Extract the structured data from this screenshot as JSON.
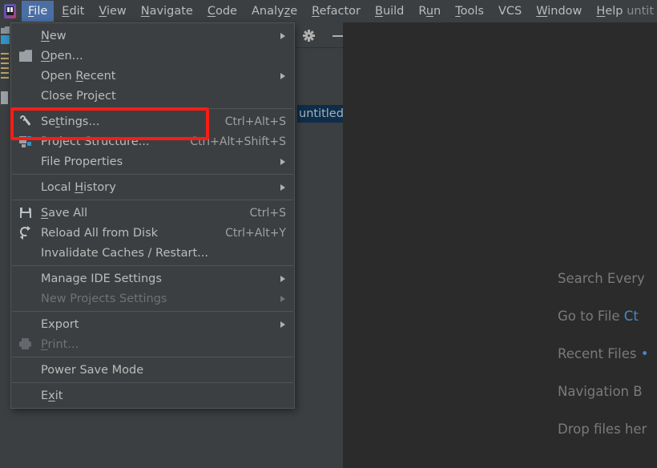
{
  "window": {
    "title": "untit",
    "app_icon": "intellij-idea-logo"
  },
  "menubar": {
    "items": [
      {
        "label": "File",
        "mnemonic": "F",
        "active": true
      },
      {
        "label": "Edit",
        "mnemonic": "E",
        "active": false
      },
      {
        "label": "View",
        "mnemonic": "V",
        "active": false
      },
      {
        "label": "Navigate",
        "mnemonic": "N",
        "active": false
      },
      {
        "label": "Code",
        "mnemonic": "C",
        "active": false
      },
      {
        "label": "Analyze",
        "mnemonic": "z",
        "active": false
      },
      {
        "label": "Refactor",
        "mnemonic": "R",
        "active": false
      },
      {
        "label": "Build",
        "mnemonic": "B",
        "active": false
      },
      {
        "label": "Run",
        "mnemonic": "u",
        "active": false
      },
      {
        "label": "Tools",
        "mnemonic": "T",
        "active": false
      },
      {
        "label": "VCS",
        "mnemonic": "",
        "active": false
      },
      {
        "label": "Window",
        "mnemonic": "W",
        "active": false
      },
      {
        "label": "Help",
        "mnemonic": "H",
        "active": false
      }
    ],
    "active_color": "#4a6fa5"
  },
  "file_menu": {
    "rows": [
      {
        "type": "item",
        "label": "New",
        "mnemonic": "N",
        "keys": "",
        "icon": "none",
        "submenu": true,
        "disabled": false
      },
      {
        "type": "item",
        "label": "Open...",
        "mnemonic": "O",
        "keys": "",
        "icon": "folder",
        "submenu": false,
        "disabled": false
      },
      {
        "type": "item",
        "label": "Open Recent",
        "mnemonic": "R",
        "keys": "",
        "icon": "none",
        "submenu": true,
        "disabled": false
      },
      {
        "type": "item",
        "label": "Close Project",
        "mnemonic": "",
        "keys": "",
        "icon": "none",
        "submenu": false,
        "disabled": false
      },
      {
        "type": "separator"
      },
      {
        "type": "item",
        "label": "Settings...",
        "mnemonic": "t",
        "keys": "Ctrl+Alt+S",
        "icon": "wrench",
        "submenu": false,
        "disabled": false,
        "highlighted": true
      },
      {
        "type": "item",
        "label": "Project Structure...",
        "mnemonic": "",
        "keys": "Ctrl+Alt+Shift+S",
        "icon": "structure",
        "submenu": false,
        "disabled": false
      },
      {
        "type": "item",
        "label": "File Properties",
        "mnemonic": "",
        "keys": "",
        "icon": "none",
        "submenu": true,
        "disabled": false
      },
      {
        "type": "separator"
      },
      {
        "type": "item",
        "label": "Local History",
        "mnemonic": "H",
        "keys": "",
        "icon": "none",
        "submenu": true,
        "disabled": false
      },
      {
        "type": "separator"
      },
      {
        "type": "item",
        "label": "Save All",
        "mnemonic": "S",
        "keys": "Ctrl+S",
        "icon": "save",
        "submenu": false,
        "disabled": false
      },
      {
        "type": "item",
        "label": "Reload All from Disk",
        "mnemonic": "",
        "keys": "Ctrl+Alt+Y",
        "icon": "reload",
        "submenu": false,
        "disabled": false
      },
      {
        "type": "item",
        "label": "Invalidate Caches / Restart...",
        "mnemonic": "",
        "keys": "",
        "icon": "none",
        "submenu": false,
        "disabled": false
      },
      {
        "type": "separator"
      },
      {
        "type": "item",
        "label": "Manage IDE Settings",
        "mnemonic": "",
        "keys": "",
        "icon": "none",
        "submenu": true,
        "disabled": false
      },
      {
        "type": "item",
        "label": "New Projects Settings",
        "mnemonic": "",
        "keys": "",
        "icon": "none",
        "submenu": true,
        "disabled": true
      },
      {
        "type": "separator"
      },
      {
        "type": "item",
        "label": "Export",
        "mnemonic": "",
        "keys": "",
        "icon": "none",
        "submenu": true,
        "disabled": false
      },
      {
        "type": "item",
        "label": "Print...",
        "mnemonic": "P",
        "keys": "",
        "icon": "print",
        "submenu": false,
        "disabled": true
      },
      {
        "type": "separator"
      },
      {
        "type": "item",
        "label": "Power Save Mode",
        "mnemonic": "",
        "keys": "",
        "icon": "none",
        "submenu": false,
        "disabled": false
      },
      {
        "type": "separator"
      },
      {
        "type": "item",
        "label": "Exit",
        "mnemonic": "x",
        "keys": "",
        "icon": "none",
        "submenu": false,
        "disabled": false
      }
    ]
  },
  "project_panel": {
    "gear_icon": "gear-icon",
    "minimize_icon": "minimize-icon",
    "selected_node": "untitled",
    "selection_color": "#0d2d4a"
  },
  "editor": {
    "hints": [
      {
        "label": "Search Every",
        "shortcut": ""
      },
      {
        "label": "Go to File",
        "shortcut": "Ct"
      },
      {
        "label": "Recent Files",
        "shortcut": "•"
      },
      {
        "label": "Navigation B",
        "shortcut": ""
      },
      {
        "label": "Drop files her",
        "shortcut": ""
      }
    ],
    "hint_color": "#7a7a7a",
    "shortcut_color": "#4a88c7",
    "background": "#2b2b2b"
  },
  "annotation": {
    "target": "Settings...",
    "box_color": "#f71d16"
  }
}
